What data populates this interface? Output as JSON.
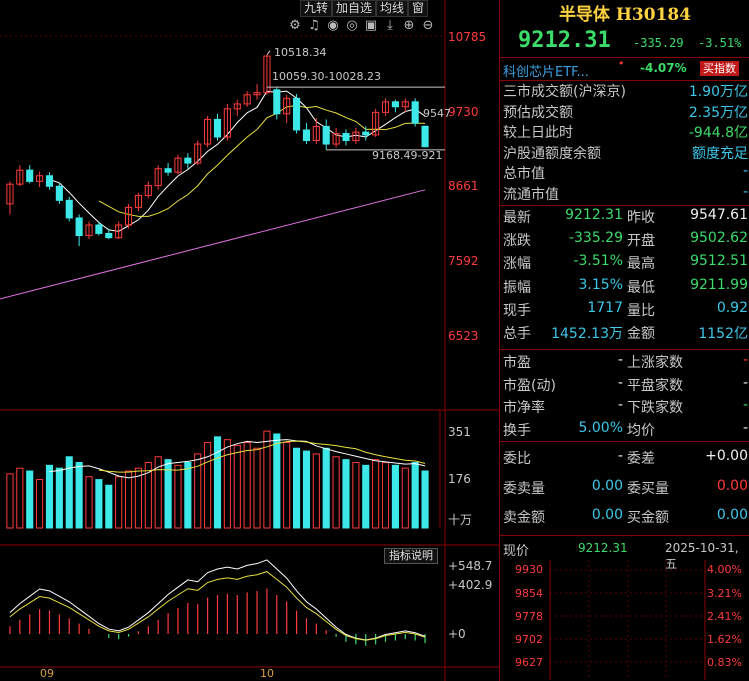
{
  "toolbar": {
    "items": [
      "九转",
      "加自选",
      "均线",
      "窗"
    ]
  },
  "icons": [
    "gear-icon",
    "bell-icon",
    "eye-icon",
    "target-icon",
    "image-icon",
    "download-icon",
    "plus-icon",
    "minus-icon"
  ],
  "icon_glyphs": [
    "⚙",
    "♫",
    "◉",
    "◎",
    "▣",
    "⤓",
    "⊕",
    "⊖"
  ],
  "price_axis": [
    "10785",
    "9730",
    "8661",
    "7592",
    "6523"
  ],
  "volume_axis": [
    "351",
    "176",
    "十万"
  ],
  "macd_axis": [
    "+548.7",
    "+402.9",
    "+0"
  ],
  "annotations": {
    "high": "10518.34",
    "range_high": "10059.30-10028.23",
    "right_price": "9547",
    "range_low": "9168.49-921"
  },
  "months": [
    "09",
    "10"
  ],
  "explain_button": "指标说明",
  "header": {
    "title": "半导体 H30184",
    "price": "9212.31",
    "change": "-335.29",
    "change_pct": "-3.51%"
  },
  "etf": {
    "name": "科创芯片ETF...",
    "dot": "•",
    "pct": "-4.07%",
    "button": "买指数"
  },
  "info_rows": [
    {
      "k": "三市成交额(沪深京)",
      "v": "1.90万亿",
      "c": "cyan"
    },
    {
      "k": "预估成交额",
      "v": "2.35万亿",
      "c": "cyan"
    },
    {
      "k": "较上日此时",
      "v": "-944.8亿",
      "c": "green"
    },
    {
      "k": "沪股通额度余额",
      "v": "额度充足",
      "c": "cyan"
    },
    {
      "k": "总市值",
      "v": "-",
      "c": "cyan"
    },
    {
      "k": "流通市值",
      "v": "-",
      "c": "cyan"
    }
  ],
  "quote_rows": [
    {
      "k1": "最新",
      "v1": "9212.31",
      "c1": "green",
      "k2": "昨收",
      "v2": "9547.61",
      "c2": "white"
    },
    {
      "k1": "涨跌",
      "v1": "-335.29",
      "c1": "green",
      "k2": "开盘",
      "v2": "9502.62",
      "c2": "green"
    },
    {
      "k1": "涨幅",
      "v1": "-3.51%",
      "c1": "green",
      "k2": "最高",
      "v2": "9512.51",
      "c2": "green"
    },
    {
      "k1": "振幅",
      "v1": "3.15%",
      "c1": "cyan",
      "k2": "最低",
      "v2": "9211.99",
      "c2": "green"
    },
    {
      "k1": "现手",
      "v1": "1717",
      "c1": "cyan",
      "k2": "量比",
      "v2": "0.92",
      "c2": "cyan"
    },
    {
      "k1": "总手",
      "v1": "1452.13万",
      "c1": "cyan",
      "k2": "金额",
      "v2": "1152亿",
      "c2": "cyan"
    }
  ],
  "valuation_rows": [
    {
      "k1": "市盈",
      "v1": "-",
      "c1": "white",
      "k2": "上涨家数",
      "v2": "-",
      "c2": "red"
    },
    {
      "k1": "市盈(动)",
      "v1": "-",
      "c1": "white",
      "k2": "平盘家数",
      "v2": "-",
      "c2": "white"
    },
    {
      "k1": "市净率",
      "v1": "-",
      "c1": "white",
      "k2": "下跌家数",
      "v2": "-",
      "c2": "green"
    },
    {
      "k1": "换手",
      "v1": "5.00%",
      "c1": "cyan",
      "k2": "均价",
      "v2": "-",
      "c2": "white"
    }
  ],
  "order_rows": [
    {
      "k1": "委比",
      "v1": "-",
      "c1": "white",
      "k2": "委差",
      "v2": "+0.00",
      "c2": "white"
    },
    {
      "k1": "委卖量",
      "v1": "0.00",
      "c1": "cyan",
      "k2": "委买量",
      "v2": "0.00",
      "c2": "red"
    },
    {
      "k1": "卖金额",
      "v1": "0.00",
      "c1": "cyan",
      "k2": "买金额",
      "v2": "0.00",
      "c2": "cyan"
    }
  ],
  "mini": {
    "label": "现价",
    "price": "9212.31",
    "date": "2025-10-31,五",
    "left_axis": [
      "9930",
      "9854",
      "9778",
      "9702",
      "9627"
    ],
    "right_axis": [
      "4.00%",
      "3.21%",
      "2.41%",
      "1.62%",
      "0.83%"
    ]
  },
  "colors": {
    "up": "#ff3b3b",
    "down": "#3ce8e8",
    "ma5": "#ffffff",
    "ma10": "#e8e040",
    "ma60": "#e070e0"
  },
  "chart_data": {
    "type": "candlestick",
    "price_range": [
      6523,
      10785
    ],
    "candles": [
      [
        8400,
        8680,
        8250,
        8720
      ],
      [
        8680,
        8880,
        8650,
        8950
      ],
      [
        8880,
        8720,
        8690,
        8950
      ],
      [
        8720,
        8800,
        8640,
        8860
      ],
      [
        8800,
        8650,
        8600,
        8850
      ],
      [
        8650,
        8450,
        8400,
        8700
      ],
      [
        8450,
        8200,
        8150,
        8500
      ],
      [
        8200,
        7950,
        7800,
        8250
      ],
      [
        7950,
        8100,
        7900,
        8150
      ],
      [
        8100,
        7980,
        7950,
        8150
      ],
      [
        7980,
        7920,
        7900,
        8050
      ],
      [
        7920,
        8100,
        7900,
        8150
      ],
      [
        8100,
        8350,
        8050,
        8400
      ],
      [
        8350,
        8520,
        8300,
        8560
      ],
      [
        8520,
        8660,
        8480,
        8720
      ],
      [
        8660,
        8900,
        8600,
        8950
      ],
      [
        8900,
        8850,
        8800,
        8980
      ],
      [
        8850,
        9050,
        8820,
        9100
      ],
      [
        9050,
        8980,
        8900,
        9120
      ],
      [
        8980,
        9250,
        8950,
        9300
      ],
      [
        9250,
        9600,
        9200,
        9650
      ],
      [
        9600,
        9350,
        9300,
        9680
      ],
      [
        9350,
        9750,
        9300,
        9820
      ],
      [
        9750,
        9820,
        9650,
        9880
      ],
      [
        9820,
        9950,
        9780,
        10000
      ],
      [
        9950,
        9980,
        9880,
        10100
      ],
      [
        9980,
        10500,
        9950,
        10518
      ],
      [
        10020,
        9680,
        9600,
        10059
      ],
      [
        9680,
        9900,
        9550,
        9950
      ],
      [
        9900,
        9450,
        9400,
        9960
      ],
      [
        9450,
        9300,
        9250,
        9550
      ],
      [
        9300,
        9500,
        9250,
        9620
      ],
      [
        9500,
        9250,
        9168,
        9600
      ],
      [
        9250,
        9400,
        9200,
        9480
      ],
      [
        9400,
        9300,
        9230,
        9460
      ],
      [
        9300,
        9420,
        9250,
        9480
      ],
      [
        9420,
        9380,
        9300,
        9500
      ],
      [
        9380,
        9700,
        9350,
        9750
      ],
      [
        9700,
        9850,
        9650,
        9900
      ],
      [
        9850,
        9780,
        9700,
        9880
      ],
      [
        9780,
        9850,
        9700,
        9900
      ],
      [
        9850,
        9547,
        9500,
        9900
      ],
      [
        9502,
        9212,
        9211,
        9512
      ]
    ],
    "volumes": [
      190,
      210,
      200,
      170,
      220,
      210,
      250,
      230,
      180,
      170,
      150,
      180,
      200,
      210,
      230,
      250,
      240,
      220,
      230,
      260,
      300,
      320,
      310,
      290,
      300,
      280,
      340,
      330,
      300,
      280,
      270,
      260,
      280,
      250,
      240,
      230,
      220,
      240,
      230,
      220,
      210,
      230,
      200
    ],
    "macd": [
      60,
      110,
      150,
      190,
      180,
      150,
      120,
      80,
      40,
      0,
      -30,
      -40,
      -20,
      20,
      60,
      110,
      160,
      200,
      240,
      230,
      280,
      300,
      310,
      300,
      320,
      330,
      350,
      300,
      250,
      180,
      120,
      80,
      30,
      -20,
      -60,
      -80,
      -90,
      -80,
      -60,
      -50,
      -40,
      -50,
      -70
    ]
  }
}
